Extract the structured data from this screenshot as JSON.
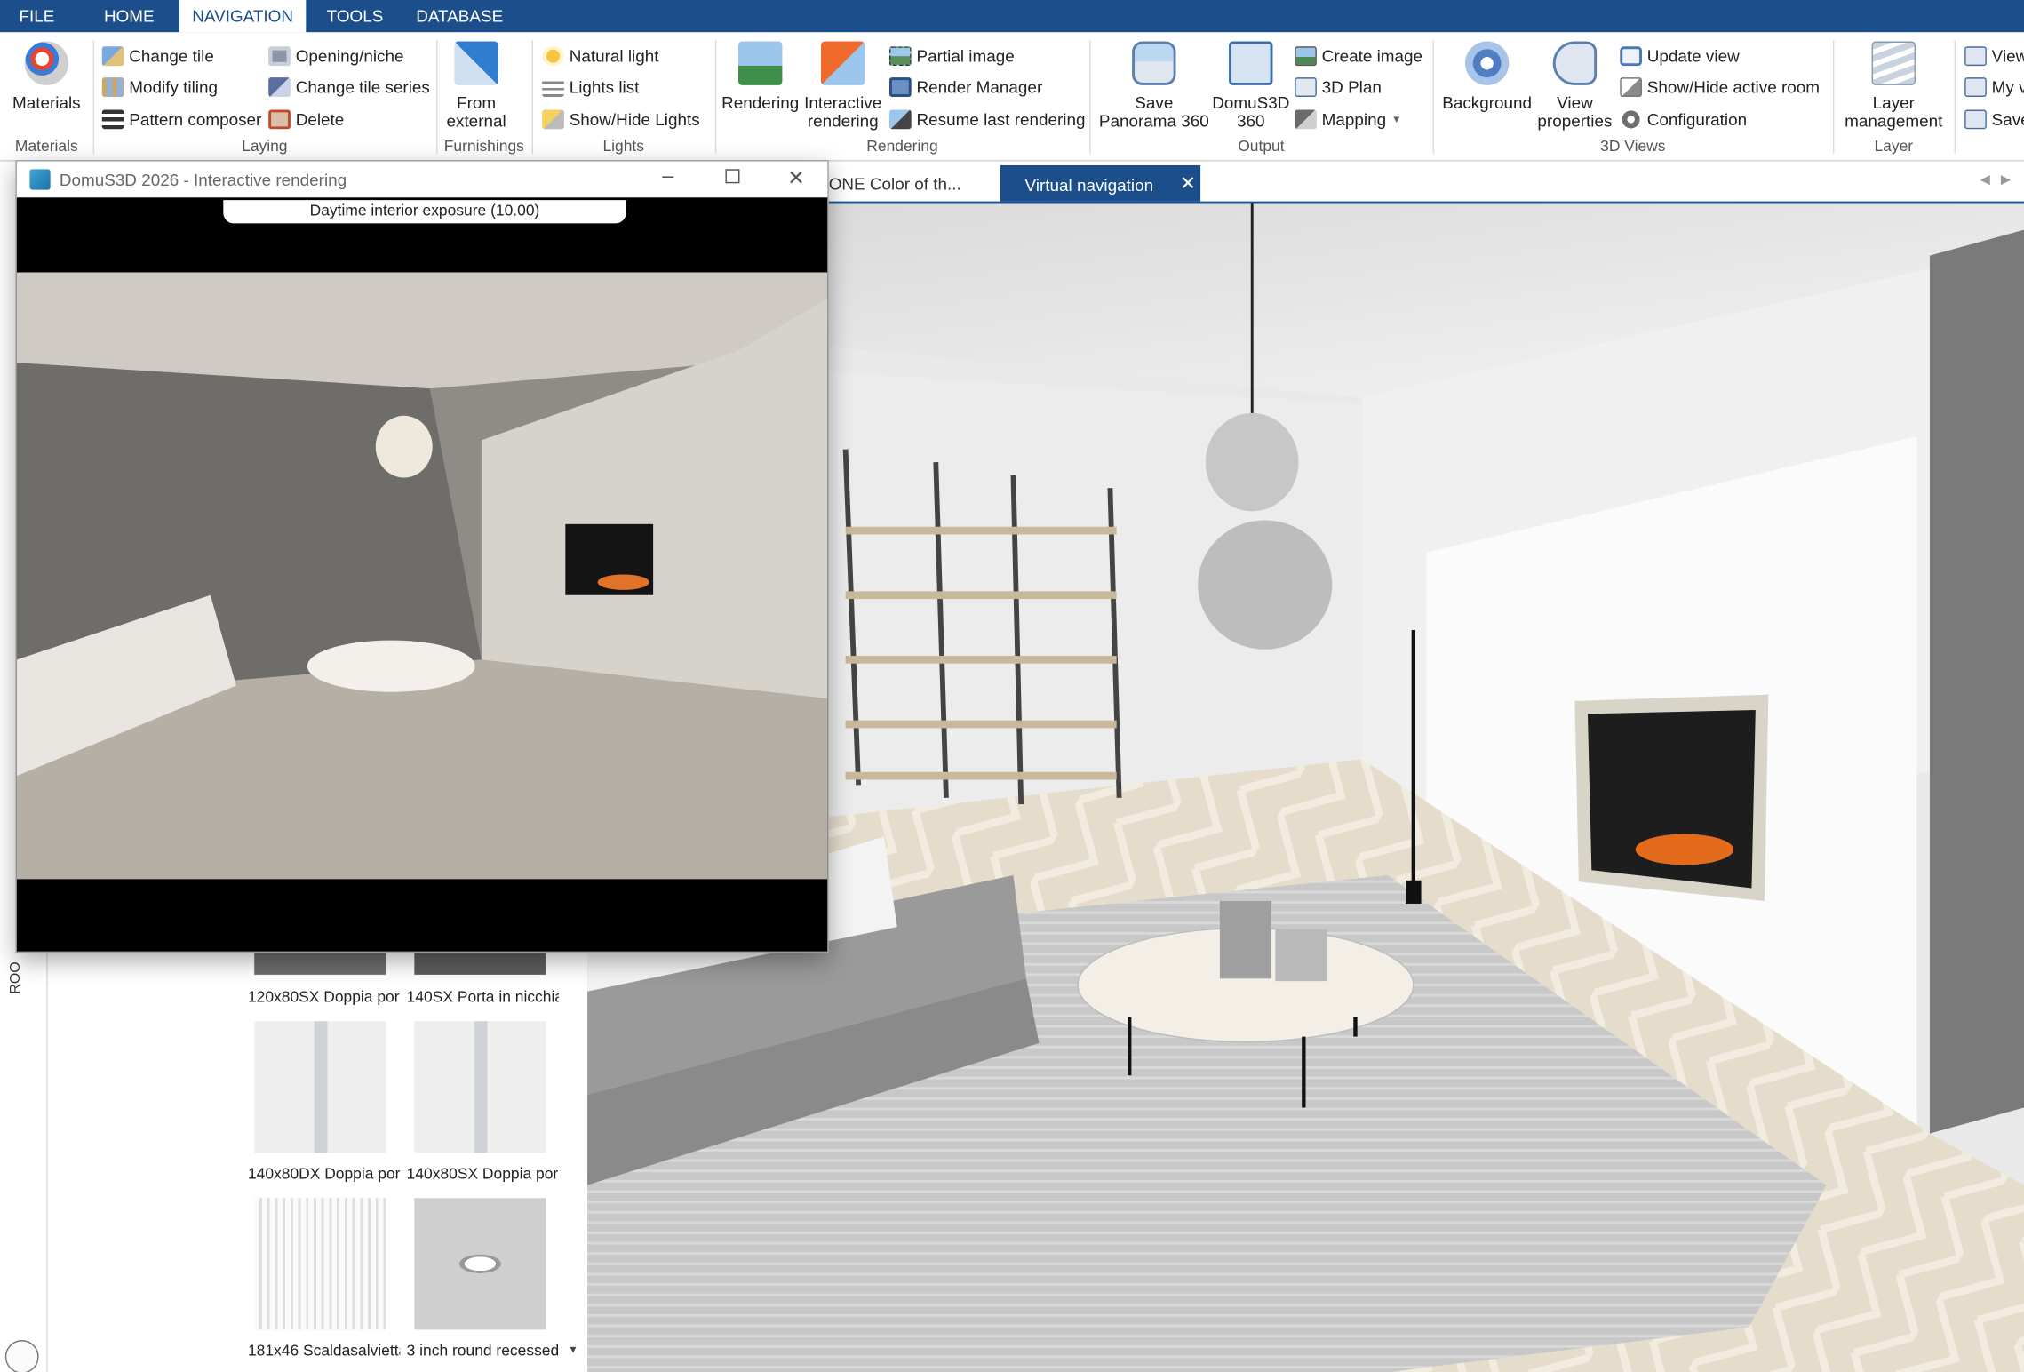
{
  "menu": {
    "tabs": [
      "FILE",
      "HOME",
      "NAVIGATION",
      "TOOLS",
      "DATABASE"
    ]
  },
  "ribbon": {
    "materials": {
      "label": "Materials",
      "group": "Materials"
    },
    "laying": {
      "change_tile": "Change tile",
      "modify_tiling": "Modify tiling",
      "pattern_composer": "Pattern composer",
      "opening_niche": "Opening/niche",
      "change_tile_series": "Change tile series",
      "delete": "Delete",
      "group": "Laying"
    },
    "furnishings": {
      "from_external_1": "From",
      "from_external_2": "external",
      "group": "Furnishings"
    },
    "lights": {
      "natural_light": "Natural light",
      "lights_list": "Lights list",
      "show_hide_lights": "Show/Hide Lights",
      "group": "Lights"
    },
    "rendering": {
      "rendering": "Rendering",
      "interactive_1": "Interactive",
      "interactive_2": "rendering",
      "partial_image": "Partial image",
      "render_manager": "Render Manager",
      "resume_last": "Resume last rendering",
      "group": "Rendering"
    },
    "output": {
      "save_pano_1": "Save",
      "save_pano_2": "Panorama 360",
      "domus_1": "DomuS3D",
      "domus_2": "360",
      "create_image": "Create image",
      "plan_3d": "3D Plan",
      "mapping": "Mapping",
      "group": "Output"
    },
    "views": {
      "background": "Background",
      "view_props_1": "View",
      "view_props_2": "properties",
      "update_view": "Update view",
      "show_hide_room": "Show/Hide active room",
      "configuration": "Configuration",
      "group": "3D Views"
    },
    "layer": {
      "layer_mgmt_1": "Layer",
      "layer_mgmt_2": "management",
      "group": "Layer"
    },
    "extra": {
      "view": "View",
      "my": "My v",
      "save": "Save"
    }
  },
  "doc_tabs": {
    "prev_tab": "ONE Color of th...",
    "active_tab": "Virtual navigation"
  },
  "floating_window": {
    "title": "DomuS3D 2026 - Interactive rendering",
    "exposure": "Daytime interior exposure (10.00)"
  },
  "side": {
    "vertical_label": "ROO"
  },
  "catalog": {
    "items": [
      "120x80SX Doppia por",
      "140SX Porta in nicchia",
      "140x80DX Doppia por",
      "140x80SX Doppia por",
      "181x46 Scaldasalvietta",
      "3 inch round recessed"
    ]
  },
  "colors": {
    "brand_blue": "#1c4e8b",
    "menu_text": "#ffffff"
  }
}
